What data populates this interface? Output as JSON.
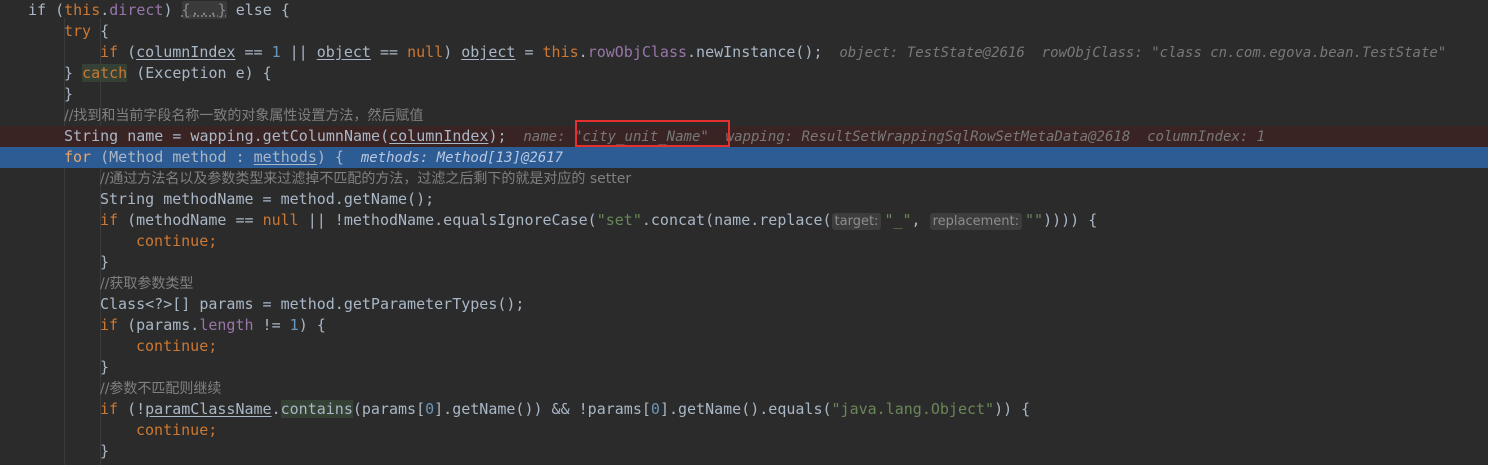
{
  "editor": {
    "lines": [
      {
        "id": "l1",
        "indent": 0,
        "bg": "",
        "tokens": [
          {
            "t": "if (",
            "c": ""
          },
          {
            "t": "this",
            "c": "kw"
          },
          {
            "t": ".",
            "c": ""
          },
          {
            "t": "direct",
            "c": "fld"
          },
          {
            "t": ") ",
            "c": ""
          },
          {
            "t": "{...}",
            "c": "fold"
          },
          {
            "t": " else {",
            "c": ""
          }
        ]
      },
      {
        "id": "l2",
        "indent": 1,
        "bg": "",
        "tokens": [
          {
            "t": "try",
            "c": "kw"
          },
          {
            "t": " {",
            "c": ""
          }
        ]
      },
      {
        "id": "l3",
        "indent": 2,
        "bg": "",
        "tokens": [
          {
            "t": "if",
            "c": "kw"
          },
          {
            "t": " (",
            "c": ""
          },
          {
            "t": "columnIndex",
            "c": "u"
          },
          {
            "t": " == ",
            "c": ""
          },
          {
            "t": "1",
            "c": "num"
          },
          {
            "t": " || ",
            "c": ""
          },
          {
            "t": "object",
            "c": "u"
          },
          {
            "t": " == ",
            "c": ""
          },
          {
            "t": "null",
            "c": "kw"
          },
          {
            "t": ") ",
            "c": ""
          },
          {
            "t": "object",
            "c": "u"
          },
          {
            "t": " = ",
            "c": ""
          },
          {
            "t": "this",
            "c": "kw"
          },
          {
            "t": ".",
            "c": ""
          },
          {
            "t": "rowObjClass",
            "c": "fld"
          },
          {
            "t": ".newInstance();",
            "c": ""
          },
          {
            "t": "  object: TestState@2616  rowObjClass: \"class cn.com.egova.bean.TestState\"",
            "c": "inline-val"
          }
        ]
      },
      {
        "id": "l4",
        "indent": 1,
        "bg": "",
        "tokens": [
          {
            "t": "} ",
            "c": ""
          },
          {
            "t": "catch",
            "c": "kw hl"
          },
          {
            "t": " (Exception e) {",
            "c": ""
          }
        ]
      },
      {
        "id": "l5",
        "indent": 1,
        "bg": "",
        "tokens": [
          {
            "t": "}",
            "c": ""
          }
        ]
      },
      {
        "id": "l6",
        "indent": 1,
        "bg": "",
        "tokens": [
          {
            "t": "//找到和当前字段名称一致的对象属性设置方法，然后赋值",
            "c": "cmt"
          }
        ]
      },
      {
        "id": "l7",
        "indent": 1,
        "bg": "bg-err",
        "tokens": [
          {
            "t": "String name = wapping.getColumnName(",
            "c": ""
          },
          {
            "t": "columnIndex",
            "c": "u"
          },
          {
            "t": ");",
            "c": ""
          },
          {
            "t": "  name: ",
            "c": "inline-val"
          },
          {
            "t": "\"city_unit_Name\"",
            "c": "inline-val"
          },
          {
            "t": "  wapping: ResultSetWrappingSqlRowSetMetaData@2618  columnIndex: 1",
            "c": "inline-val"
          }
        ]
      },
      {
        "id": "l8",
        "indent": 1,
        "bg": "bg-exec",
        "tokens": [
          {
            "t": "for",
            "c": "kw-exec"
          },
          {
            "t": " (Method method : ",
            "c": ""
          },
          {
            "t": "methods",
            "c": "u"
          },
          {
            "t": ") {",
            "c": ""
          },
          {
            "t": "  methods: Method[13]@2617",
            "c": "inline-val inline-exec"
          }
        ]
      },
      {
        "id": "l9",
        "indent": 2,
        "bg": "",
        "tokens": [
          {
            "t": "//通过方法名以及参数类型来过滤掉不匹配的方法，过滤之后剩下的就是对应的 setter",
            "c": "cmt"
          }
        ]
      },
      {
        "id": "l10",
        "indent": 2,
        "bg": "",
        "tokens": [
          {
            "t": "String methodName = method.getName();",
            "c": ""
          }
        ]
      },
      {
        "id": "l11",
        "indent": 2,
        "bg": "",
        "tokens": [
          {
            "t": "if",
            "c": "kw"
          },
          {
            "t": " (methodName == ",
            "c": ""
          },
          {
            "t": "null",
            "c": "kw"
          },
          {
            "t": " || !methodName.equalsIgnoreCase(",
            "c": ""
          },
          {
            "t": "\"set\"",
            "c": "str"
          },
          {
            "t": ".concat(name.replace(",
            "c": ""
          },
          {
            "t": "target:",
            "c": "hint"
          },
          {
            "t": "\"_\"",
            "c": "str"
          },
          {
            "t": ", ",
            "c": ""
          },
          {
            "t": "replacement:",
            "c": "hint"
          },
          {
            "t": "\"\"",
            "c": "str"
          },
          {
            "t": ")))) {",
            "c": ""
          }
        ]
      },
      {
        "id": "l12",
        "indent": 3,
        "bg": "",
        "tokens": [
          {
            "t": "continue",
            "c": "kw"
          },
          {
            "t": ";",
            "c": "kw"
          }
        ]
      },
      {
        "id": "l13",
        "indent": 2,
        "bg": "",
        "tokens": [
          {
            "t": "}",
            "c": ""
          }
        ]
      },
      {
        "id": "l14",
        "indent": 2,
        "bg": "",
        "tokens": [
          {
            "t": "//获取参数类型",
            "c": "cmt"
          }
        ]
      },
      {
        "id": "l15",
        "indent": 2,
        "bg": "",
        "tokens": [
          {
            "t": "Class<?>[] params = method.getParameterTypes();",
            "c": ""
          }
        ]
      },
      {
        "id": "l16",
        "indent": 2,
        "bg": "",
        "tokens": [
          {
            "t": "if",
            "c": "kw"
          },
          {
            "t": " (params.",
            "c": ""
          },
          {
            "t": "length",
            "c": "fld"
          },
          {
            "t": " != ",
            "c": ""
          },
          {
            "t": "1",
            "c": "num"
          },
          {
            "t": ") {",
            "c": ""
          }
        ]
      },
      {
        "id": "l17",
        "indent": 3,
        "bg": "",
        "tokens": [
          {
            "t": "continue",
            "c": "kw"
          },
          {
            "t": ";",
            "c": "kw"
          }
        ]
      },
      {
        "id": "l18",
        "indent": 2,
        "bg": "",
        "tokens": [
          {
            "t": "}",
            "c": ""
          }
        ]
      },
      {
        "id": "l19",
        "indent": 2,
        "bg": "",
        "tokens": [
          {
            "t": "//参数不匹配则继续",
            "c": "cmt"
          }
        ]
      },
      {
        "id": "l20",
        "indent": 2,
        "bg": "",
        "tokens": [
          {
            "t": "if",
            "c": "kw"
          },
          {
            "t": " (!",
            "c": ""
          },
          {
            "t": "paramClassName",
            "c": "u"
          },
          {
            "t": ".",
            "c": ""
          },
          {
            "t": "contains",
            "c": "hl"
          },
          {
            "t": "(params[",
            "c": ""
          },
          {
            "t": "0",
            "c": "num"
          },
          {
            "t": "].getName()) && !params[",
            "c": ""
          },
          {
            "t": "0",
            "c": "num"
          },
          {
            "t": "].getName().equals(",
            "c": ""
          },
          {
            "t": "\"java.lang.Object\"",
            "c": "str"
          },
          {
            "t": ")) {",
            "c": ""
          }
        ]
      },
      {
        "id": "l21",
        "indent": 3,
        "bg": "",
        "tokens": [
          {
            "t": "continue",
            "c": "kw"
          },
          {
            "t": ";",
            "c": "kw"
          }
        ]
      },
      {
        "id": "l22",
        "indent": 2,
        "bg": "",
        "tokens": [
          {
            "t": "}",
            "c": ""
          }
        ]
      }
    ]
  },
  "colors": {
    "background": "#2b2b2b",
    "execution_line": "#2d5b93",
    "error_line": "#3a2323",
    "highlight_box": "#e53030"
  }
}
